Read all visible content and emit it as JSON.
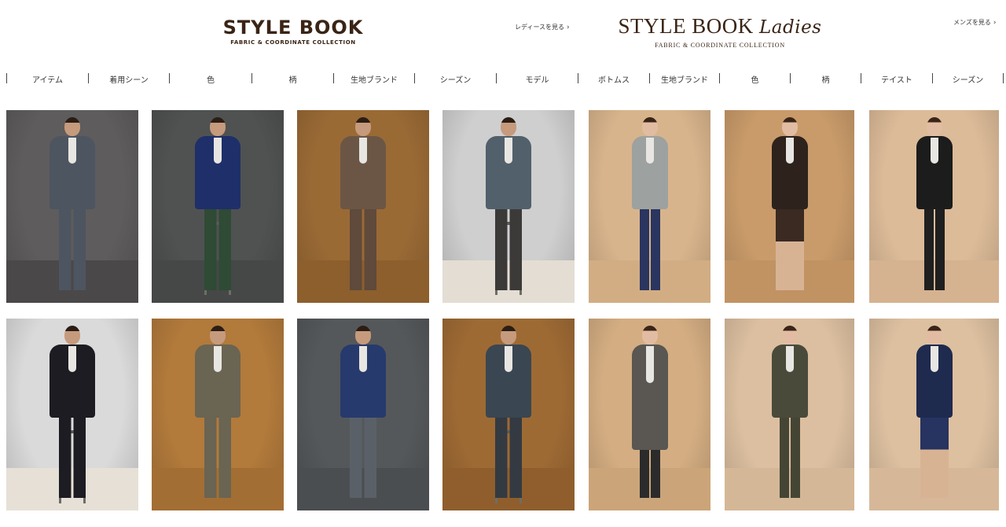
{
  "header": {
    "men_logo": {
      "title": "STYLE BOOK",
      "subtitle": "FABRIC & COORDINATE COLLECTION"
    },
    "ladies_logo": {
      "title": "STYLE BOOK",
      "title_script": "Ladies",
      "subtitle": "FABRIC & COORDINATE COLLECTION"
    },
    "link_to_ladies": "レディースを見る",
    "link_to_mens": "メンズを見る",
    "chevron": "›"
  },
  "nav_men": [
    "アイテム",
    "着用シーン",
    "色",
    "柄",
    "生地ブランド",
    "シーズン",
    "モデル"
  ],
  "nav_ladies": [
    "ボトムス",
    "生地ブランド",
    "色",
    "柄",
    "テイスト",
    "シーズン"
  ],
  "cards": [
    {
      "name": "look-men-1",
      "bg": "#5e5c5c",
      "suit": "#4d5560",
      "legs": "#4d5560",
      "floor": "#4a4848",
      "pose": "stand"
    },
    {
      "name": "look-men-2",
      "bg": "#4f5251",
      "suit": "#1e2f6a",
      "legs": "#2f4a35",
      "floor": "#454847",
      "pose": "stool"
    },
    {
      "name": "look-men-3",
      "bg": "#9a6a35",
      "suit": "#6b5646",
      "legs": "#5f4a3b",
      "floor": "#8c5f2d",
      "pose": "stand"
    },
    {
      "name": "look-men-4",
      "bg": "#cfcfcf",
      "suit": "#51606b",
      "legs": "#3c3a38",
      "floor": "#e3ddd3",
      "pose": "stool"
    },
    {
      "name": "look-ladies-1",
      "bg": "#d8b48c",
      "suit": "#9da1a0",
      "legs": "#2a3560",
      "floor": "#d2ad84",
      "pose": "stand"
    },
    {
      "name": "look-ladies-2",
      "bg": "#c99b6a",
      "suit": "#2e221d",
      "legs": "#3a2a22",
      "floor": "#c19363",
      "pose": "skirt"
    },
    {
      "name": "look-ladies-3",
      "bg": "#dcbb98",
      "suit": "#1c1c1c",
      "legs": "#1f1f1f",
      "floor": "#d5b290",
      "pose": "stand"
    },
    {
      "name": "look-men-5",
      "bg": "#dadada",
      "suit": "#1c1c22",
      "legs": "#1c1c22",
      "floor": "#e6e0d6",
      "pose": "stool"
    },
    {
      "name": "look-men-6",
      "bg": "#b27a3b",
      "suit": "#6a6452",
      "legs": "#6a6452",
      "floor": "#a36e33",
      "pose": "stand"
    },
    {
      "name": "look-men-7",
      "bg": "#55585a",
      "suit": "#273a6d",
      "legs": "#5a6068",
      "floor": "#4b4e50",
      "pose": "stand"
    },
    {
      "name": "look-men-8",
      "bg": "#9e6a34",
      "suit": "#3a4651",
      "legs": "#343a42",
      "floor": "#8f5e2c",
      "pose": "stool"
    },
    {
      "name": "look-ladies-4",
      "bg": "#d4ad82",
      "suit": "#5a5652",
      "legs": "#2b2b2b",
      "floor": "#cba579",
      "pose": "coat"
    },
    {
      "name": "look-ladies-5",
      "bg": "#dcbfa0",
      "suit": "#4a4a3a",
      "legs": "#454535",
      "floor": "#d4b797",
      "pose": "stand"
    },
    {
      "name": "look-ladies-6",
      "bg": "#ddc0a0",
      "suit": "#1f2a4f",
      "legs": "#273360",
      "floor": "#d6b898",
      "pose": "skirt"
    }
  ]
}
